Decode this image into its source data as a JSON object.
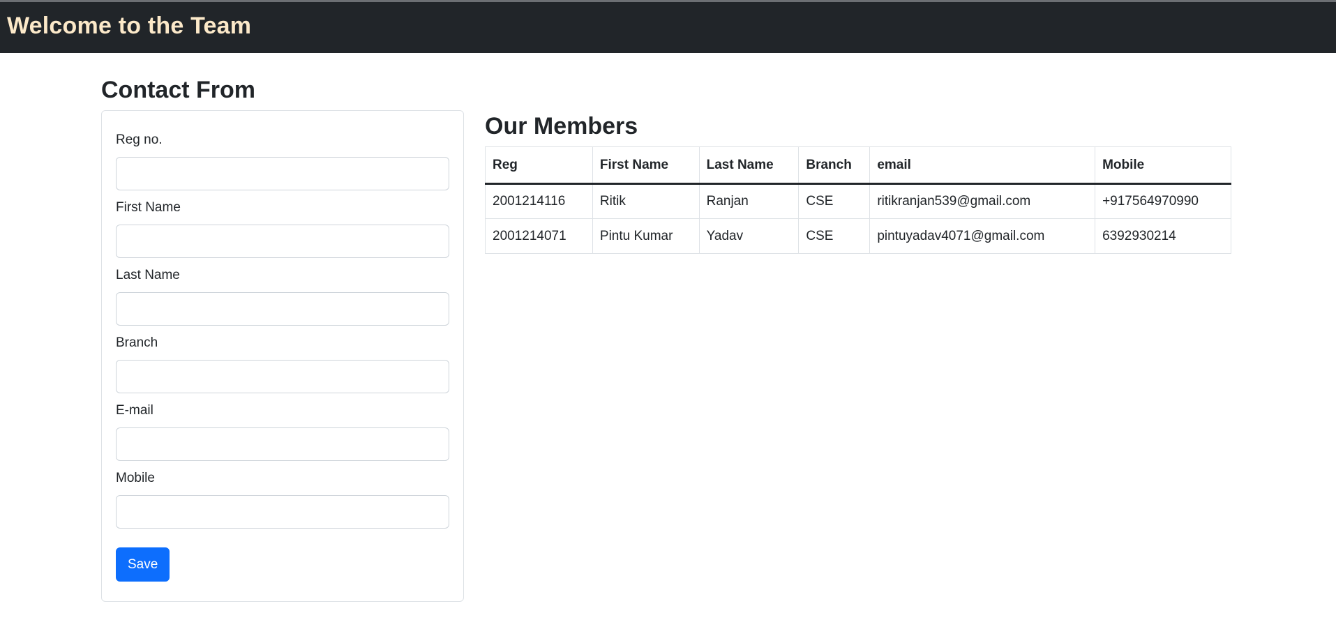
{
  "header": {
    "title": "Welcome to the Team"
  },
  "form": {
    "title": "Contact From",
    "fields": [
      {
        "label": "Reg no.",
        "value": "",
        "placeholder": ""
      },
      {
        "label": "First Name",
        "value": "",
        "placeholder": ""
      },
      {
        "label": "Last Name",
        "value": "",
        "placeholder": ""
      },
      {
        "label": "Branch",
        "value": "",
        "placeholder": ""
      },
      {
        "label": "E-mail",
        "value": "",
        "placeholder": ""
      },
      {
        "label": "Mobile",
        "value": "",
        "placeholder": ""
      }
    ],
    "save_label": "Save"
  },
  "members": {
    "title": "Our Members",
    "columns": [
      "Reg",
      "First Name",
      "Last Name",
      "Branch",
      "email",
      "Mobile"
    ],
    "rows": [
      [
        "2001214116",
        "Ritik",
        "Ranjan",
        "CSE",
        "ritikranjan539@gmail.com",
        "+917564970990"
      ],
      [
        "2001214071",
        "Pintu Kumar",
        "Yadav",
        "CSE",
        "pintuyadav4071@gmail.com",
        "6392930214"
      ]
    ]
  },
  "colors": {
    "navbar_bg": "#212529",
    "brand_text": "#fce9c9",
    "primary_button": "#0d6efd",
    "border": "#dee2e6"
  }
}
